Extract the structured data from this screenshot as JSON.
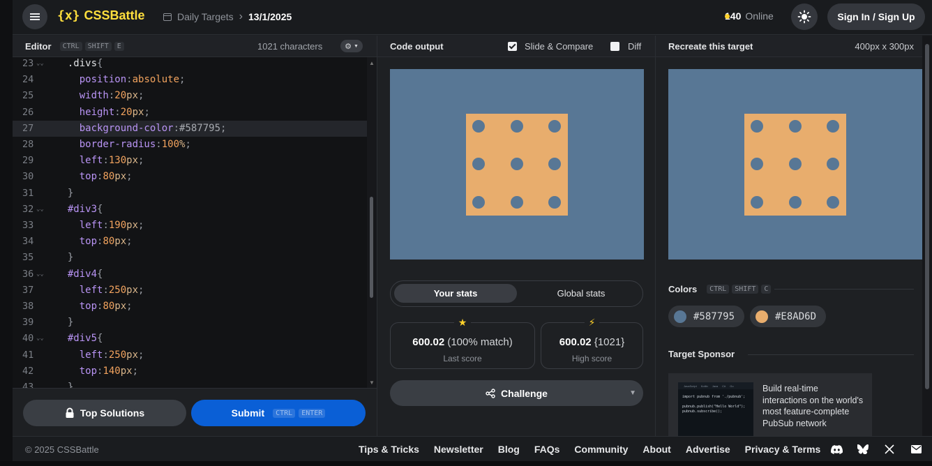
{
  "header": {
    "logo_brace": "{x}",
    "logo_name": "CSSBattle",
    "breadcrumb_section": "Daily Targets",
    "breadcrumb_date": "13/1/2025",
    "online_count": "140",
    "online_label": "Online",
    "signin_label": "Sign In / Sign Up"
  },
  "editor": {
    "title": "Editor",
    "shortcut": [
      "CTRL",
      "SHIFT",
      "E"
    ],
    "chars": "1021 characters",
    "lines": [
      {
        "n": "23",
        "fold": true,
        "parts": [
          [
            "sel",
            "  .divs"
          ],
          [
            "punc",
            "{"
          ]
        ]
      },
      {
        "n": "24",
        "fold": false,
        "parts": [
          [
            "prop",
            "    position"
          ],
          [
            "punc",
            ":"
          ],
          [
            "num",
            "absolute"
          ],
          [
            "punc",
            ";"
          ]
        ]
      },
      {
        "n": "25",
        "fold": false,
        "parts": [
          [
            "prop",
            "    width"
          ],
          [
            "punc",
            ":"
          ],
          [
            "num",
            "20"
          ],
          [
            "unit",
            "px"
          ],
          [
            "punc",
            ";"
          ]
        ]
      },
      {
        "n": "26",
        "fold": false,
        "parts": [
          [
            "prop",
            "    height"
          ],
          [
            "punc",
            ":"
          ],
          [
            "num",
            "20"
          ],
          [
            "unit",
            "px"
          ],
          [
            "punc",
            ";"
          ]
        ]
      },
      {
        "n": "27",
        "fold": false,
        "active": true,
        "parts": [
          [
            "prop",
            "    background-color"
          ],
          [
            "punc",
            ":"
          ],
          [
            "hex",
            "#587795"
          ],
          [
            "punc",
            ";"
          ]
        ]
      },
      {
        "n": "28",
        "fold": false,
        "parts": [
          [
            "prop",
            "    border-radius"
          ],
          [
            "punc",
            ":"
          ],
          [
            "num",
            "100"
          ],
          [
            "unit",
            "%"
          ],
          [
            "punc",
            ";"
          ]
        ]
      },
      {
        "n": "29",
        "fold": false,
        "parts": [
          [
            "prop",
            "    left"
          ],
          [
            "punc",
            ":"
          ],
          [
            "num",
            "130"
          ],
          [
            "unit",
            "px"
          ],
          [
            "punc",
            ";"
          ]
        ]
      },
      {
        "n": "30",
        "fold": false,
        "parts": [
          [
            "prop",
            "    top"
          ],
          [
            "punc",
            ":"
          ],
          [
            "num",
            "80"
          ],
          [
            "unit",
            "px"
          ],
          [
            "punc",
            ";"
          ]
        ]
      },
      {
        "n": "31",
        "fold": false,
        "parts": [
          [
            "punc",
            "  }"
          ]
        ]
      },
      {
        "n": "32",
        "fold": true,
        "parts": [
          [
            "id",
            "  #div3"
          ],
          [
            "punc",
            "{"
          ]
        ]
      },
      {
        "n": "33",
        "fold": false,
        "parts": [
          [
            "prop",
            "    left"
          ],
          [
            "punc",
            ":"
          ],
          [
            "num",
            "190"
          ],
          [
            "unit",
            "px"
          ],
          [
            "punc",
            ";"
          ]
        ]
      },
      {
        "n": "34",
        "fold": false,
        "parts": [
          [
            "prop",
            "    top"
          ],
          [
            "punc",
            ":"
          ],
          [
            "num",
            "80"
          ],
          [
            "unit",
            "px"
          ],
          [
            "punc",
            ";"
          ]
        ]
      },
      {
        "n": "35",
        "fold": false,
        "parts": [
          [
            "punc",
            "  }"
          ]
        ]
      },
      {
        "n": "36",
        "fold": true,
        "parts": [
          [
            "id",
            "  #div4"
          ],
          [
            "punc",
            "{"
          ]
        ]
      },
      {
        "n": "37",
        "fold": false,
        "parts": [
          [
            "prop",
            "    left"
          ],
          [
            "punc",
            ":"
          ],
          [
            "num",
            "250"
          ],
          [
            "unit",
            "px"
          ],
          [
            "punc",
            ";"
          ]
        ]
      },
      {
        "n": "38",
        "fold": false,
        "parts": [
          [
            "prop",
            "    top"
          ],
          [
            "punc",
            ":"
          ],
          [
            "num",
            "80"
          ],
          [
            "unit",
            "px"
          ],
          [
            "punc",
            ";"
          ]
        ]
      },
      {
        "n": "39",
        "fold": false,
        "parts": [
          [
            "punc",
            "  }"
          ]
        ]
      },
      {
        "n": "40",
        "fold": true,
        "parts": [
          [
            "id",
            "  #div5"
          ],
          [
            "punc",
            "{"
          ]
        ]
      },
      {
        "n": "41",
        "fold": false,
        "parts": [
          [
            "prop",
            "    left"
          ],
          [
            "punc",
            ":"
          ],
          [
            "num",
            "250"
          ],
          [
            "unit",
            "px"
          ],
          [
            "punc",
            ";"
          ]
        ]
      },
      {
        "n": "42",
        "fold": false,
        "parts": [
          [
            "prop",
            "    top"
          ],
          [
            "punc",
            ":"
          ],
          [
            "num",
            "140"
          ],
          [
            "unit",
            "px"
          ],
          [
            "punc",
            ";"
          ]
        ]
      },
      {
        "n": "43",
        "fold": false,
        "parts": [
          [
            "punc",
            "  }"
          ]
        ]
      }
    ],
    "top_solutions_label": "Top Solutions",
    "submit_label": "Submit",
    "submit_shortcut": [
      "CTRL",
      "ENTER"
    ]
  },
  "output": {
    "title": "Code output",
    "slide_compare_label": "Slide & Compare",
    "slide_compare_checked": true,
    "diff_label": "Diff",
    "diff_checked": false,
    "tab_your": "Your stats",
    "tab_global": "Global stats",
    "last_score_value": "600.02",
    "last_score_match": "(100% match)",
    "last_score_label": "Last score",
    "high_score_value": "600.02",
    "high_score_chars": "{1021}",
    "high_score_label": "High score",
    "challenge_label": "Challenge"
  },
  "target": {
    "title": "Recreate this target",
    "size": "400px x 300px",
    "colors_label": "Colors",
    "colors_shortcut": [
      "CTRL",
      "SHIFT",
      "C"
    ],
    "colors": [
      {
        "hex": "#587795",
        "label": "#587795"
      },
      {
        "hex": "#E8AD6D",
        "label": "#E8AD6D"
      }
    ],
    "sponsor_label": "Target Sponsor",
    "ad_text": "Build real-time interactions on the world's most feature-complete PubSub network",
    "ad_tabs": [
      "JavaScript",
      "Kotlin",
      "Java",
      "C#",
      "Go"
    ],
    "ad_code": "import pubnub from './pubnub';\n\npubnub.publish(\"Hello World\");\npubnub.subscribe();"
  },
  "footer": {
    "copyright": "© 2025 CSSBattle",
    "links": [
      "Tips & Tricks",
      "Newsletter",
      "Blog",
      "FAQs",
      "Community",
      "About",
      "Advertise",
      "Privacy & Terms"
    ],
    "icons": [
      "discord-icon",
      "bluesky-icon",
      "x-icon",
      "mail-icon"
    ]
  },
  "palette": {
    "bg": "#587795",
    "square": "#E8AD6D",
    "accent": "#FFDF3D",
    "submit": "#0A5FD6"
  }
}
